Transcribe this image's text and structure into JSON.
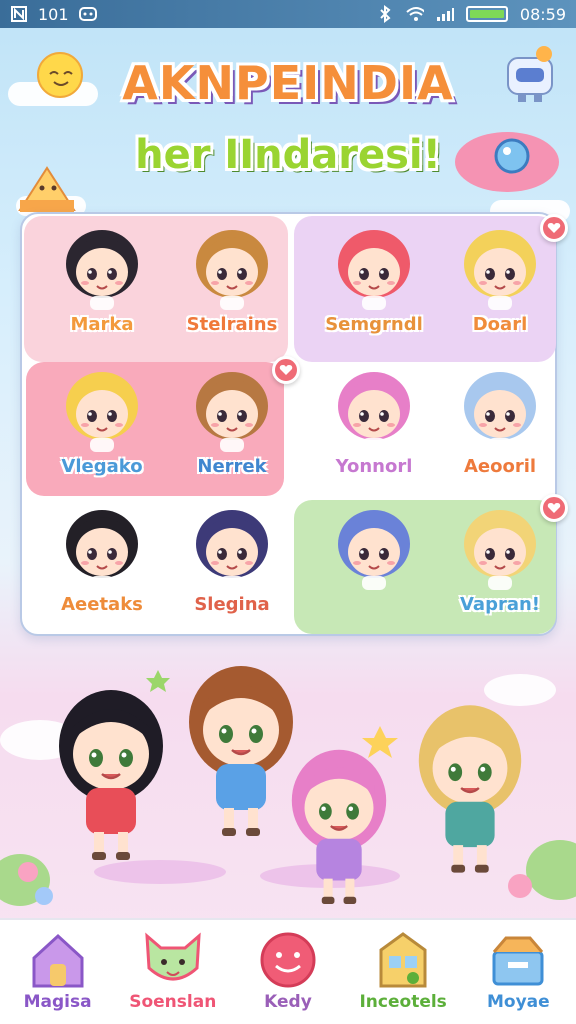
{
  "status_bar": {
    "time_left": "101",
    "clock": "08:59",
    "battery_level": 1.0,
    "colors": {
      "battery": "#7ed957"
    }
  },
  "header": {
    "title": "AKNPEINDIA",
    "subtitle": "her IIndaresi!"
  },
  "characters": [
    {
      "name": "Marka",
      "color": "#f39a3c",
      "hair": "#2b2630",
      "favorite": false
    },
    {
      "name": "Stelrains",
      "color": "#f0793a",
      "hair": "#c9893f",
      "favorite": false
    },
    {
      "name": "Semgrndl",
      "color": "#e8923a",
      "hair": "#ef5a6a",
      "favorite": false
    },
    {
      "name": "Doarl",
      "color": "#f08c3a",
      "hair": "#f3d15a",
      "favorite": true
    },
    {
      "name": "Vlegako",
      "color": "#4a9ad8",
      "hair": "#f6cf4e",
      "favorite": false
    },
    {
      "name": "Nerrek",
      "color": "#3f86cf",
      "hair": "#b77842",
      "favorite": true
    },
    {
      "name": "Yonnorl",
      "color": "#c678d0",
      "hair": "#e77fc8",
      "favorite": false
    },
    {
      "name": "Aeooril",
      "color": "#ee7a3c",
      "hair": "#a8c8ee",
      "favorite": false
    },
    {
      "name": "Aeetaks",
      "color": "#ee8c3a",
      "hair": "#232027",
      "favorite": false
    },
    {
      "name": "Slegina",
      "color": "#e0624a",
      "hair": "#3d3a78",
      "favorite": false
    },
    {
      "name": "",
      "color": "#e0624a",
      "hair": "#6a82d8",
      "favorite": false
    },
    {
      "name": "Vapran!",
      "color": "#4aa0d8",
      "hair": "#f2d477",
      "favorite": true
    }
  ],
  "nav": [
    {
      "label": "Magisa",
      "color": "#8a57c7",
      "icon": "house-icon"
    },
    {
      "label": "Soenslan",
      "color": "#ef5575",
      "icon": "cat-icon"
    },
    {
      "label": "Kedy",
      "color": "#9a5fb8",
      "icon": "smiley-icon"
    },
    {
      "label": "Inceotels",
      "color": "#5caf3a",
      "icon": "shop-icon"
    },
    {
      "label": "Moyae",
      "color": "#3f8fd6",
      "icon": "box-icon"
    }
  ]
}
